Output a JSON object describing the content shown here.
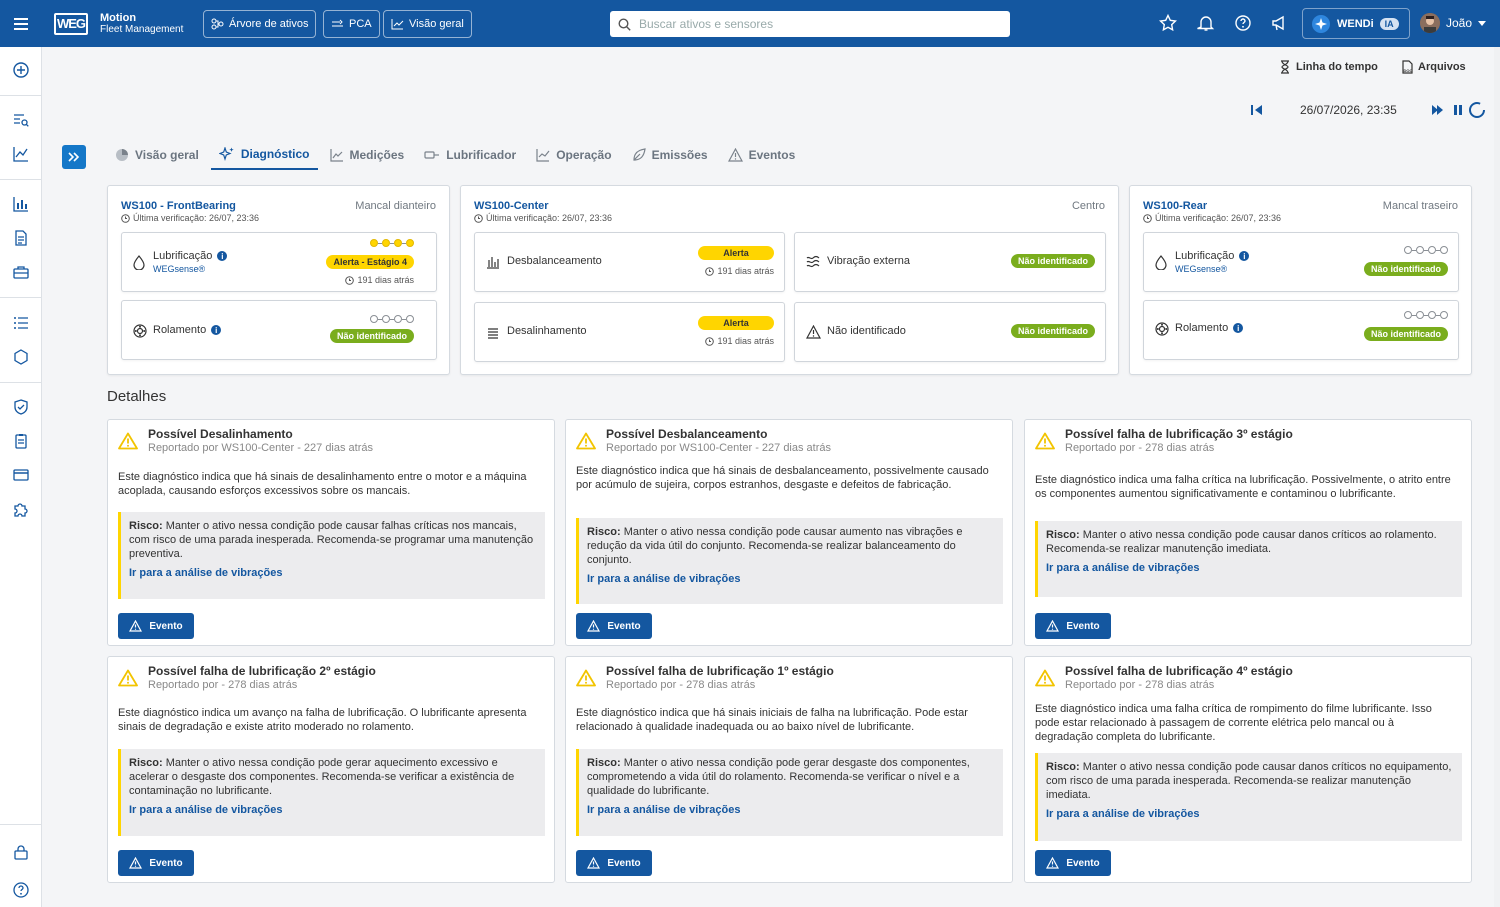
{
  "header": {
    "logo_text": "WEG",
    "app_name": "Motion",
    "app_sub": "Fleet Management",
    "nav": [
      {
        "label": "Árvore de ativos",
        "icon": "asset-tree-icon"
      },
      {
        "label": "PCA",
        "icon": "pca-icon"
      },
      {
        "label": "Visão geral",
        "icon": "chart-line-icon"
      }
    ],
    "search_placeholder": "Buscar ativos e sensores",
    "wendi_label": "WENDi",
    "ia_label": "IA",
    "user_name": "João"
  },
  "toolbar": {
    "timeline_label": "Linha do tempo",
    "files_label": "Arquivos",
    "datetime": "26/07/2026, 23:35"
  },
  "tabs": [
    {
      "label": "Visão geral",
      "icon": "pie-icon"
    },
    {
      "label": "Diagnóstico",
      "icon": "sparkle-icon",
      "active": true
    },
    {
      "label": "Medições",
      "icon": "line-chart-icon"
    },
    {
      "label": "Lubrificador",
      "icon": "lubricator-icon"
    },
    {
      "label": "Operação",
      "icon": "operation-icon"
    },
    {
      "label": "Emissões",
      "icon": "leaf-icon"
    },
    {
      "label": "Eventos",
      "icon": "warning-icon"
    }
  ],
  "devices": {
    "front": {
      "title": "WS100 - FrontBearing",
      "location": "Mancal dianteiro",
      "last_check": "Última verificação: 26/07, 23:36",
      "lub_label": "Lubrificação",
      "lub_brand": "WEGsense®",
      "lub_badge": "Alerta - Estágio 4",
      "lub_ago": "191 dias atrás",
      "lub_stage": 4,
      "rol_label": "Rolamento",
      "rol_badge": "Não identificado",
      "rol_stage": 0
    },
    "center": {
      "title": "WS100-Center",
      "location": "Centro",
      "last_check": "Última verificação: 26/07, 23:36",
      "desb_label": "Desbalanceamento",
      "desb_badge": "Alerta",
      "desb_ago": "191 dias atrás",
      "vib_label": "Vibração externa",
      "vib_badge": "Não identificado",
      "desal_label": "Desalinhamento",
      "desal_badge": "Alerta",
      "desal_ago": "191 dias atrás",
      "ni_label": "Não identificado",
      "ni_badge": "Não identificado"
    },
    "rear": {
      "title": "WS100-Rear",
      "location": "Mancal traseiro",
      "last_check": "Última verificação: 26/07, 23:36",
      "lub_label": "Lubrificação",
      "lub_brand": "WEGsense®",
      "lub_badge": "Não identificado",
      "lub_stage": 0,
      "rol_label": "Rolamento",
      "rol_badge": "Não identificado",
      "rol_stage": 0
    }
  },
  "details_title": "Detalhes",
  "risk_prefix": "Risco:",
  "link_label": "Ir para a análise de vibrações",
  "event_label": "Evento",
  "details": [
    {
      "title": "Possível Desalinhamento",
      "reported": "Reportado por WS100-Center - 227 dias atrás",
      "desc": "Este diagnóstico indica que há sinais de desalinhamento entre o motor e a máquina acoplada, causando esforços excessivos sobre os mancais.",
      "risk": "Manter o ativo nessa condição pode causar falhas críticas nos mancais, com risco de uma parada inesperada. Recomenda-se programar uma manutenção preventiva."
    },
    {
      "title": "Possível Desbalanceamento",
      "reported": "Reportado por WS100-Center - 227 dias atrás",
      "desc": "Este diagnóstico indica que há sinais de desbalanceamento, possivelmente causado por acúmulo de sujeira, corpos estranhos, desgaste e defeitos de fabricação.",
      "risk": "Manter o ativo nessa condição pode causar aumento nas vibrações e redução da vida útil do conjunto. Recomenda-se realizar balanceamento do conjunto."
    },
    {
      "title": "Possível falha de lubrificação 3º estágio",
      "reported": "Reportado por - 278 dias atrás",
      "desc": "Este diagnóstico indica uma falha crítica na lubrificação. Possivelmente, o atrito entre os componentes aumentou significativamente e contaminou o lubrificante.",
      "risk": "Manter o ativo nessa condição pode causar danos críticos ao rolamento. Recomenda-se realizar manutenção imediata."
    },
    {
      "title": "Possível falha de lubrificação 2º estágio",
      "reported": "Reportado por - 278 dias atrás",
      "desc": "Este diagnóstico indica um avanço na falha de lubrificação. O lubrificante apresenta sinais de degradação e existe atrito moderado no rolamento.",
      "risk": "Manter o ativo nessa condição pode gerar aquecimento excessivo e acelerar o desgaste dos componentes. Recomenda-se verificar a existência de contaminação no lubrificante."
    },
    {
      "title": "Possível falha de lubrificação 1º estágio",
      "reported": "Reportado por - 278 dias atrás",
      "desc": "Este diagnóstico indica que há sinais iniciais de falha na lubrificação. Pode estar relacionado à qualidade inadequada ou ao baixo nível de lubrificante.",
      "risk": "Manter o ativo nessa condição pode gerar desgaste dos componentes, comprometendo a vida útil do rolamento. Recomenda-se verificar o nível e a qualidade do lubrificante."
    },
    {
      "title": "Possível falha de lubrificação 4º estágio",
      "reported": "Reportado por - 278 dias atrás",
      "desc": "Este diagnóstico indica uma falha crítica de rompimento do filme lubrificante. Isso pode estar relacionado à passagem de corrente elétrica pelo mancal ou à degradação completa do lubrificante.",
      "risk": "Manter o ativo nessa condição pode causar danos críticos no equipamento, com risco de uma parada inesperada. Recomenda-se realizar manutenção imediata."
    }
  ],
  "colors": {
    "primary": "#1457a0",
    "alert": "#ffd500",
    "not_identified": "#7aad1d"
  }
}
